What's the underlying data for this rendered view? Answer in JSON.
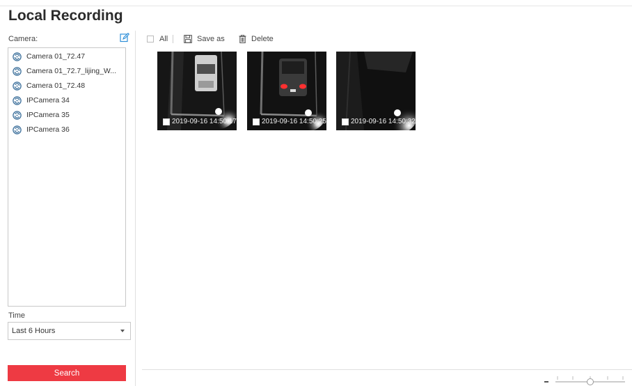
{
  "page": {
    "title": "Local Recording"
  },
  "camera_panel": {
    "label": "Camera:",
    "edit_icon": "edit-icon",
    "cameras": [
      {
        "name": "Camera 01_72.47"
      },
      {
        "name": "Camera 01_72.7_lijing_W..."
      },
      {
        "name": "Camera 01_72.48"
      },
      {
        "name": "IPCamera 34"
      },
      {
        "name": "IPCamera 35"
      },
      {
        "name": "IPCamera 36"
      }
    ],
    "camera_icon": "camera-icon"
  },
  "time": {
    "label": "Time",
    "selected": "Last 6 Hours"
  },
  "search": {
    "label": "Search"
  },
  "toolbar": {
    "all_label": "All",
    "save_as_label": "Save as",
    "delete_label": "Delete",
    "save_icon": "floppy-disk-icon",
    "delete_icon": "trash-icon"
  },
  "thumbnails": [
    {
      "timestamp": "2019-09-16 14:50:17"
    },
    {
      "timestamp": "2019-09-16 14:50:25"
    },
    {
      "timestamp": "2019-09-16 14:50:32"
    }
  ],
  "colors": {
    "accent_red": "#ee3a43",
    "icon_blue": "#2f8fd8",
    "camera_icon_blue": "#3a6e9a"
  }
}
